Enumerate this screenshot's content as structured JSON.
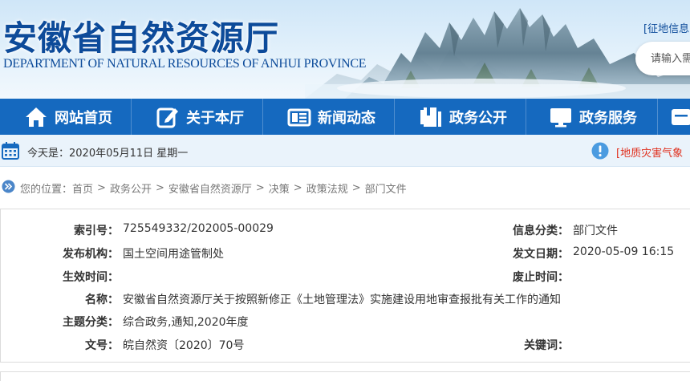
{
  "header": {
    "title": "安徽省自然资源厅",
    "subtitle": "DEPARTMENT OF NATURAL RESOURCES OF ANHUI PROVINCE",
    "top_link": "[征地信息",
    "search_placeholder": "请输入需"
  },
  "nav": {
    "items": [
      {
        "label": "网站首页",
        "icon": "home-icon"
      },
      {
        "label": "关于本厅",
        "icon": "edit-icon"
      },
      {
        "label": "新闻动态",
        "icon": "news-icon"
      },
      {
        "label": "政务公开",
        "icon": "document-icon"
      },
      {
        "label": "政务服务",
        "icon": "monitor-icon"
      }
    ]
  },
  "datebar": {
    "date_text": "今天是：2020年05月11日 星期一",
    "notice_text": "[地质灾害气象"
  },
  "breadcrumb": {
    "prefix": "您的位置：",
    "items": [
      "首页",
      "政务公开",
      "安徽省自然资源厅",
      "决策",
      "政策法规",
      "部门文件"
    ],
    "separator": ">"
  },
  "info": {
    "index_no_label": "索引号：",
    "index_no_value": "725549332/202005-00029",
    "category_label": "信息分类：",
    "category_value": "部门文件",
    "issuer_label": "发布机构：",
    "issuer_value": "国土空间用途管制处",
    "issue_date_label": "发文日期：",
    "issue_date_value": "2020-05-09 16:15",
    "effective_label": "生效时间：",
    "effective_value": "",
    "expiry_label": "废止时间：",
    "expiry_value": "",
    "name_label": "名称：",
    "name_value": "安徽省自然资源厅关于按照新修正《土地管理法》实施建设用地审查报批有关工作的通知",
    "topic_label": "主题分类：",
    "topic_value": "综合政务,通知,2020年度",
    "doc_no_label": "文号：",
    "doc_no_value": "皖自然资〔2020〕70号",
    "keywords_label": "关键词：",
    "keywords_value": ""
  },
  "colors": {
    "brand_blue": "#0d4b9a",
    "nav_blue": "#1569bf",
    "notice_red": "#e0301e"
  }
}
